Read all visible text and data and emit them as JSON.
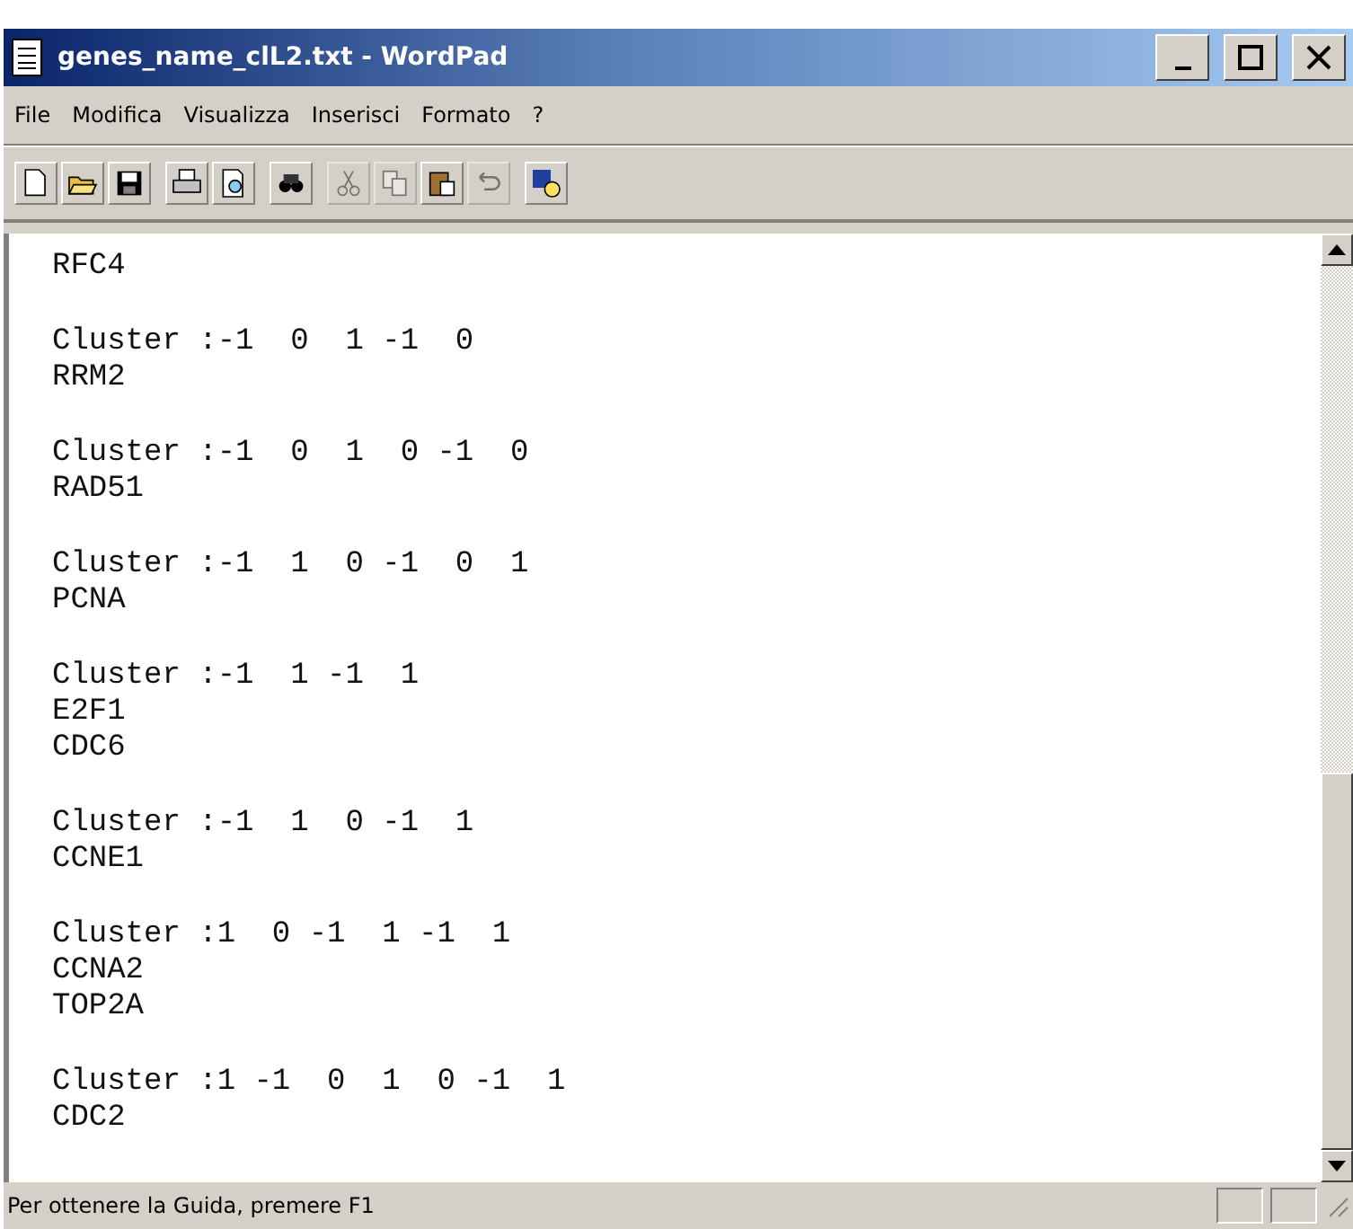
{
  "window": {
    "title": "genes_name_clL2.txt - WordPad"
  },
  "menu": [
    {
      "label": "File"
    },
    {
      "label": "Modifica"
    },
    {
      "label": "Visualizza"
    },
    {
      "label": "Inserisci"
    },
    {
      "label": "Formato"
    },
    {
      "label": "?"
    }
  ],
  "toolbar": [
    [
      {
        "kind": "new",
        "disabled": false
      },
      {
        "kind": "open",
        "disabled": false
      },
      {
        "kind": "save",
        "disabled": false
      }
    ],
    [
      {
        "kind": "print",
        "disabled": false
      },
      {
        "kind": "preview",
        "disabled": false
      }
    ],
    [
      {
        "kind": "find",
        "disabled": false
      }
    ],
    [
      {
        "kind": "cut",
        "disabled": true
      },
      {
        "kind": "copy",
        "disabled": true
      },
      {
        "kind": "paste",
        "disabled": false
      },
      {
        "kind": "undo",
        "disabled": true
      }
    ],
    [
      {
        "kind": "datetime",
        "disabled": false
      }
    ]
  ],
  "document": [
    {
      "genes": [
        "RFC4"
      ]
    },
    {
      "cluster": "Cluster :-1  0  1 -1  0",
      "genes": [
        "RRM2"
      ]
    },
    {
      "cluster": "Cluster :-1  0  1  0 -1  0",
      "genes": [
        "RAD51"
      ]
    },
    {
      "cluster": "Cluster :-1  1  0 -1  0  1",
      "genes": [
        "PCNA"
      ]
    },
    {
      "cluster": "Cluster :-1  1 -1  1",
      "genes": [
        "E2F1",
        "CDC6"
      ]
    },
    {
      "cluster": "Cluster :-1  1  0 -1  1",
      "genes": [
        "CCNE1"
      ]
    },
    {
      "cluster": "Cluster :1  0 -1  1 -1  1",
      "genes": [
        "CCNA2",
        "TOP2A"
      ]
    },
    {
      "cluster": "Cluster :1 -1  0  1  0 -1  1",
      "genes": [
        "CDC2"
      ]
    }
  ],
  "status_bar": {
    "text": "Per ottenere la Guida, premere F1"
  }
}
